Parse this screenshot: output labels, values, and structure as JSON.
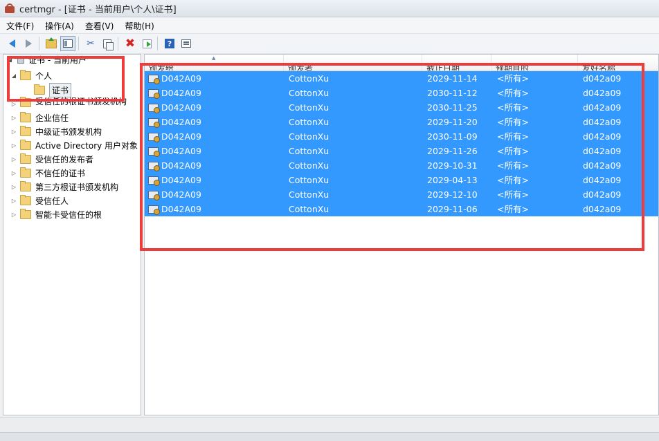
{
  "window": {
    "title": "certmgr - [证书 - 当前用户\\个人\\证书]"
  },
  "menu": [
    "文件(F)",
    "操作(A)",
    "查看(V)",
    "帮助(H)"
  ],
  "toolbar": [
    "back-icon",
    "forward-icon",
    "up-folder-icon",
    "show-hide-tree-icon",
    "cut-icon",
    "copy-icon",
    "delete-icon",
    "export-icon",
    "help-icon",
    "properties-icon"
  ],
  "tree": {
    "root": "证书 - 当前用户",
    "personal": "个人",
    "certs": "证书",
    "items": [
      "受信任的根证书颁发机构",
      "企业信任",
      "中级证书颁发机构",
      "Active Directory 用户对象",
      "受信任的发布者",
      "不信任的证书",
      "第三方根证书颁发机构",
      "受信任人",
      "智能卡受信任的根"
    ]
  },
  "columns": [
    "颁发给",
    "颁发者",
    "截止日期",
    "预期目的",
    "友好名称"
  ],
  "rows": [
    [
      "D042A09",
      "CottonXu",
      "2029-11-14",
      "<所有>",
      "d042a09"
    ],
    [
      "D042A09",
      "CottonXu",
      "2030-11-12",
      "<所有>",
      "d042a09"
    ],
    [
      "D042A09",
      "CottonXu",
      "2030-11-25",
      "<所有>",
      "d042a09"
    ],
    [
      "D042A09",
      "CottonXu",
      "2029-11-20",
      "<所有>",
      "d042a09"
    ],
    [
      "D042A09",
      "CottonXu",
      "2030-11-09",
      "<所有>",
      "d042a09"
    ],
    [
      "D042A09",
      "CottonXu",
      "2029-11-26",
      "<所有>",
      "d042a09"
    ],
    [
      "D042A09",
      "CottonXu",
      "2029-10-31",
      "<所有>",
      "d042a09"
    ],
    [
      "D042A09",
      "CottonXu",
      "2029-04-13",
      "<所有>",
      "d042a09"
    ],
    [
      "D042A09",
      "CottonXu",
      "2029-12-10",
      "<所有>",
      "d042a09"
    ],
    [
      "D042A09",
      "CottonXu",
      "2029-11-06",
      "<所有>",
      "d042a09"
    ]
  ],
  "colors": {
    "selection": "#3399ff",
    "annotation": "#ee3b3b"
  }
}
